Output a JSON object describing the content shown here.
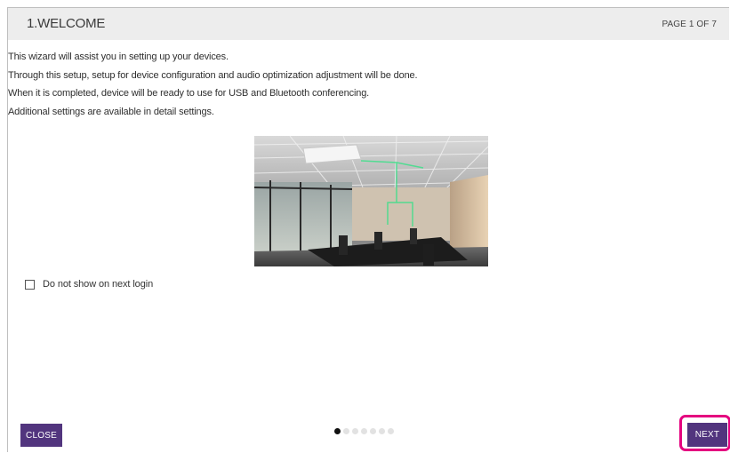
{
  "header": {
    "title": "1.WELCOME",
    "page_indicator": "PAGE 1 OF 7"
  },
  "intro": {
    "lines": [
      "This wizard will assist you in setting up your devices.",
      "Through this setup, setup for device configuration and audio optimization adjustment will be done.",
      "When it is completed, device will be ready to use for USB and Bluetooth conferencing.",
      "Additional settings are available in detail settings."
    ]
  },
  "checkbox": {
    "label": "Do not show on next login",
    "checked": false
  },
  "buttons": {
    "close_label": "CLOSE",
    "next_label": "NEXT"
  },
  "pager": {
    "current_page": 1,
    "total_pages": 7
  },
  "colors": {
    "button_bg": "#52357e",
    "highlight": "#e4007f",
    "header_bg": "#ededed",
    "beam": "#3fe08a"
  }
}
